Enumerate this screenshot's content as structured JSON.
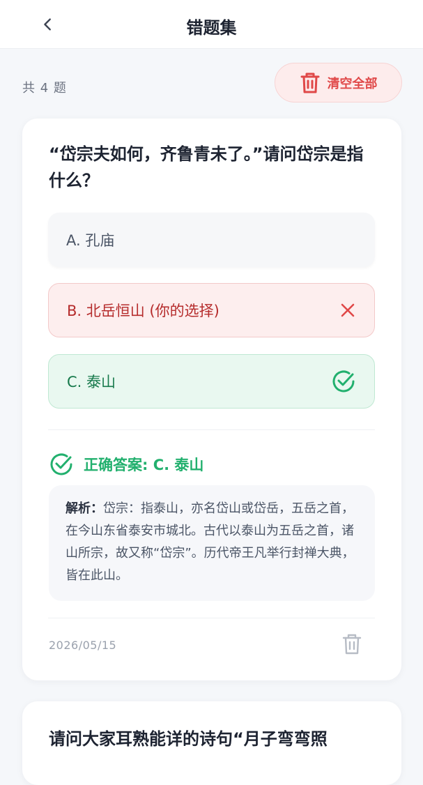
{
  "header": {
    "title": "错题集",
    "back_icon": "chevron-left-icon"
  },
  "summary": {
    "count_text": "共 4 题"
  },
  "clear_button": {
    "label": "清空全部",
    "icon": "trash-icon",
    "color": "#e04848"
  },
  "card1": {
    "question": "“岱宗夫如何，齐鲁青未了。”请问岱宗是指什么？",
    "options": [
      {
        "label": "A. 孔庙",
        "state": "normal"
      },
      {
        "label": "B. 北岳恒山 (你的选择)",
        "state": "wrong",
        "icon": "close-icon"
      },
      {
        "label": "C. 泰山",
        "state": "correct",
        "icon": "check-circle-icon"
      }
    ],
    "correct_answer": "正确答案: C. 泰山",
    "analysis_head": "解析：",
    "analysis_body": "岱宗：指泰山，亦名岱山或岱岳，五岳之首，在今山东省泰安市城北。古代以泰山为五岳之首，诸山所宗，故又称“岱宗”。历代帝王凡举行封禅大典，皆在此山。",
    "date": "2026/05/15"
  },
  "card2": {
    "question": "请问大家耳熟能详的诗句“月子弯弯照"
  },
  "colors": {
    "wrong": "#e04848",
    "correct": "#22b06e",
    "background": "#f5f7fa"
  }
}
